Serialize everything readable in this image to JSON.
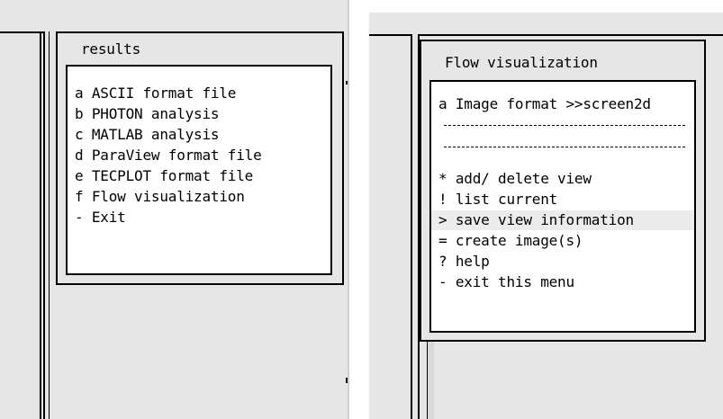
{
  "left_panel": {
    "title": "results",
    "items": [
      "a ASCII format file",
      "b PHOTON analysis",
      "c MATLAB analysis",
      "d ParaView format file",
      "e TECPLOT format file",
      "f Flow visualization",
      "- Exit"
    ]
  },
  "right_panel": {
    "title": "Flow visualization",
    "items": [
      "a Image format >>screen2d",
      "* add/ delete view",
      "! list current",
      "> save view information",
      "= create image(s)",
      "? help",
      "- exit this menu"
    ],
    "highlighted_item": "> save view information"
  },
  "colors": {
    "window_gray": "#e6e6e6",
    "highlight": "#ececec",
    "border": "#000000"
  }
}
